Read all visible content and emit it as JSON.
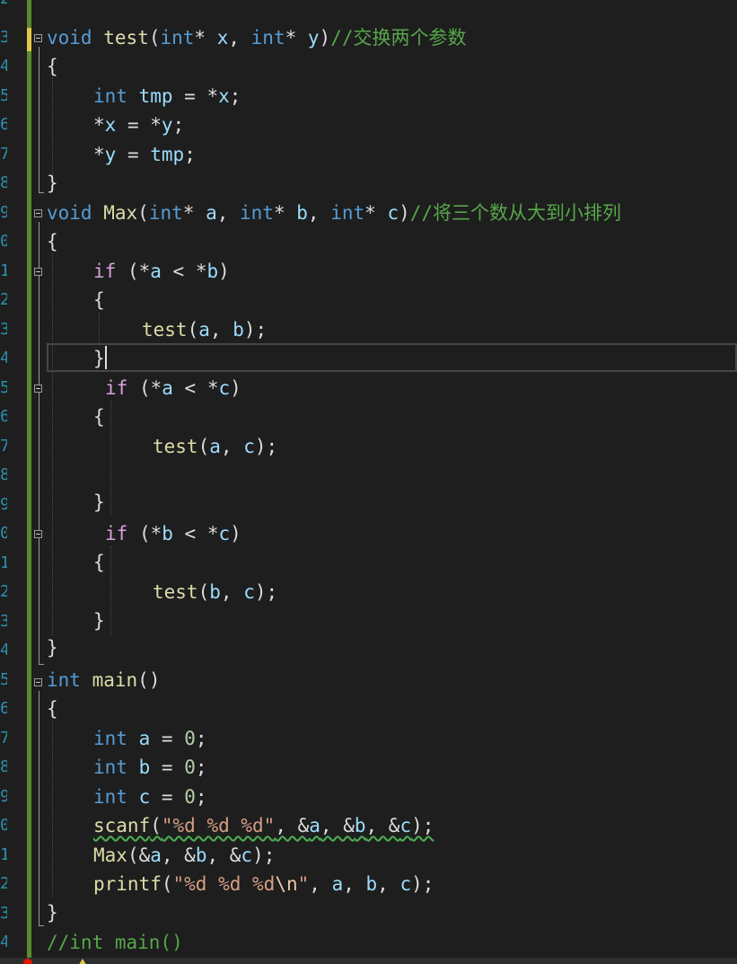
{
  "editor": {
    "language": "C",
    "line_numbers": [
      "2",
      "3",
      "4",
      "5",
      "6",
      "7",
      "8",
      "9",
      "0",
      "1",
      "2",
      "3",
      "4",
      "5",
      "6",
      "7",
      "8",
      "9",
      "0",
      "1",
      "2",
      "3",
      "4",
      "5",
      "6",
      "7",
      "8",
      "9",
      "0",
      "1",
      "2",
      "3",
      "4"
    ],
    "lines": {
      "l1": [
        "void",
        " ",
        "test",
        "(",
        "int",
        "* ",
        "x",
        ", ",
        "int",
        "* ",
        "y",
        ")",
        "//交换两个参数"
      ],
      "l2": [
        "{"
      ],
      "l3": [
        "int",
        " ",
        "tmp",
        " = *",
        "x",
        ";"
      ],
      "l4": [
        "*",
        "x",
        " = *",
        "y",
        ";"
      ],
      "l5": [
        "*",
        "y",
        " = ",
        "tmp",
        ";"
      ],
      "l6": [
        "}"
      ],
      "l7": [
        "void",
        " ",
        "Max",
        "(",
        "int",
        "* ",
        "a",
        ", ",
        "int",
        "* ",
        "b",
        ", ",
        "int",
        "* ",
        "c",
        ")",
        "//将三个数从大到小排列"
      ],
      "l8": [
        "{"
      ],
      "l9": [
        "if",
        " (*",
        "a",
        " < *",
        "b",
        ")"
      ],
      "l10": [
        "{"
      ],
      "l11": [
        "test",
        "(",
        "a",
        ", ",
        "b",
        ");"
      ],
      "l12": [
        "}"
      ],
      "l13": [
        "if",
        " (*",
        "a",
        " < *",
        "c",
        ")"
      ],
      "l14": [
        "{"
      ],
      "l15": [
        "test",
        "(",
        "a",
        ", ",
        "c",
        ");"
      ],
      "l16": [
        "}"
      ],
      "l17": [
        "if",
        " (*",
        "b",
        " < *",
        "c",
        ")"
      ],
      "l18": [
        "{"
      ],
      "l19": [
        "test",
        "(",
        "b",
        ", ",
        "c",
        ");"
      ],
      "l20": [
        "}"
      ],
      "l21": [
        "}"
      ],
      "l22": [
        "int",
        " ",
        "main",
        "()"
      ],
      "l23": [
        "{"
      ],
      "l24": [
        "int",
        " ",
        "a",
        " = ",
        "0",
        ";"
      ],
      "l25": [
        "int",
        " ",
        "b",
        " = ",
        "0",
        ";"
      ],
      "l26": [
        "int",
        " ",
        "c",
        " = ",
        "0",
        ";"
      ],
      "l27": [
        "scanf",
        "(",
        "\"%d %d %d\"",
        ", &",
        "a",
        ", &",
        "b",
        ", &",
        "c",
        ");"
      ],
      "l28": [
        "Max",
        "(&",
        "a",
        ", &",
        "b",
        ", &",
        "c",
        ");"
      ],
      "l29": [
        "printf",
        "(",
        "\"%d %d %d",
        "\\n",
        "\"",
        ", ",
        "a",
        ", ",
        "b",
        ", ",
        "c",
        ");"
      ],
      "l30": [
        "}"
      ],
      "l31": [
        "//int main()"
      ]
    },
    "colors": {
      "background": "#1e1e1e",
      "keyword": "#569cd6",
      "control": "#d8a0df",
      "function": "#dcdcaa",
      "variable": "#9cdcfe",
      "number": "#b5cea8",
      "string": "#d69d85",
      "comment": "#57a64a",
      "line_number": "#2b91af",
      "change_bar": "#5a8a2e"
    },
    "icons": [
      "fold-collapse-icon",
      "error-icon",
      "warning-icon"
    ]
  }
}
